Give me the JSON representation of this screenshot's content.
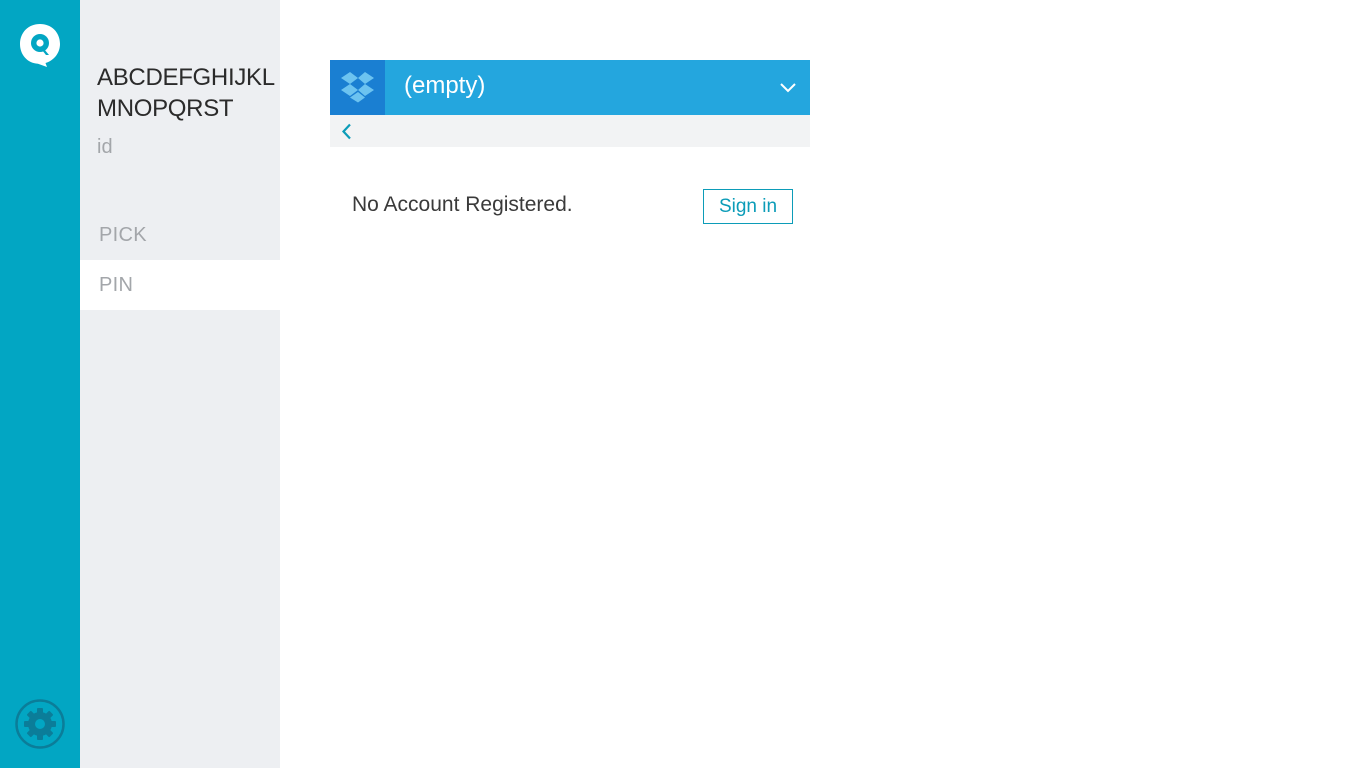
{
  "colors": {
    "rail": "#02a6c3",
    "panel": "#edeff2",
    "header": "#24a6de",
    "header_icon_bg": "#1a7fd2",
    "accent": "#0c9cb8"
  },
  "rail": {
    "logo_icon": "chat-bubble-logo-icon",
    "settings_icon": "gear-icon"
  },
  "account": {
    "name": "ABCDEFGHIJKLMNOPQRST",
    "id": "id"
  },
  "nav": {
    "items": [
      {
        "label": "PICK",
        "selected": false
      },
      {
        "label": "PIN",
        "selected": true
      }
    ]
  },
  "service": {
    "icon": "dropbox-icon",
    "selected": "(empty)",
    "dropdown_icon": "chevron-down-icon",
    "back_icon": "chevron-left-icon"
  },
  "main": {
    "message": "No Account Registered.",
    "signin_label": "Sign in"
  }
}
